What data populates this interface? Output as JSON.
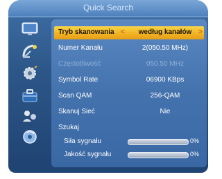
{
  "window": {
    "title": "Quick Search"
  },
  "sidebar": {
    "icons": [
      {
        "name": "tv-monitor-icon"
      },
      {
        "name": "satellite-dish-icon"
      },
      {
        "name": "settings-gear-icon"
      },
      {
        "name": "toolbox-icon"
      },
      {
        "name": "users-icon"
      },
      {
        "name": "disc-icon"
      }
    ]
  },
  "form": {
    "rows": [
      {
        "label": "Tryb skanowania",
        "value": "według kanałów",
        "selected": true
      },
      {
        "label": "Numer Kanału",
        "value": "2(050.50 MHz)"
      },
      {
        "label": "Częstotliwość",
        "value": "050.50 MHz",
        "dim": true
      },
      {
        "label": "Symbol Rate",
        "value": "06900 KBps"
      },
      {
        "label": "Scan QAM",
        "value": "256-QAM"
      },
      {
        "label": "Skanuj Sieć",
        "value": "Nie"
      },
      {
        "label": "Szukaj",
        "value": ""
      }
    ],
    "signal": {
      "strength_label": "Siła sygnału",
      "strength_percent_text": "0%",
      "strength_level": 0,
      "quality_label": "Jakość sygnału",
      "quality_percent_text": "0%",
      "quality_level": 0
    },
    "arrows": {
      "left": "<",
      "right": ">"
    }
  },
  "colors": {
    "panel_blue": "#4372ad",
    "selected_yellow": "#f0b423",
    "arrow_orange": "#d95b10"
  }
}
